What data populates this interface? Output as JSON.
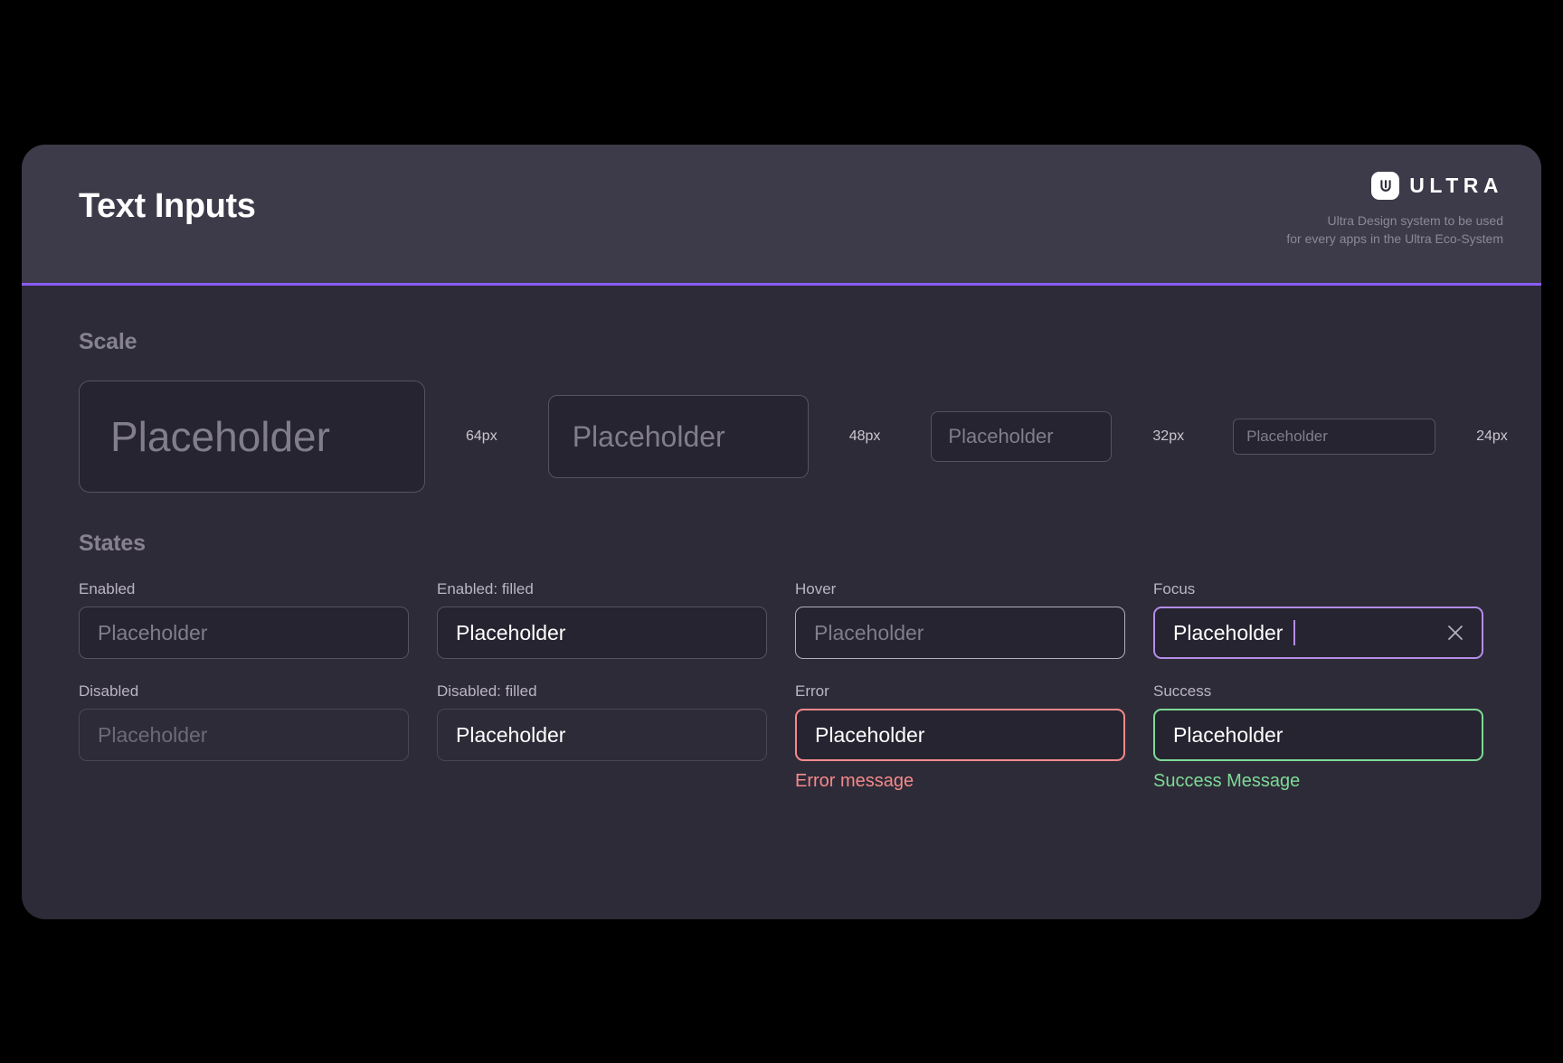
{
  "header": {
    "title": "Text Inputs",
    "brand_name": "ULTRA",
    "brand_icon": "ultra-logo-icon",
    "tagline": "Ultra Design system to be used\nfor every apps in the Ultra Eco-System",
    "accent_color": "#8b5cf6"
  },
  "scale": {
    "title": "Scale",
    "items": [
      {
        "placeholder": "Placeholder",
        "size_label": "64px"
      },
      {
        "placeholder": "Placeholder",
        "size_label": "48px"
      },
      {
        "placeholder": "Placeholder",
        "size_label": "32px"
      },
      {
        "placeholder": "Placeholder",
        "size_label": "24px"
      }
    ]
  },
  "states": {
    "title": "States",
    "row1": [
      {
        "label": "Enabled",
        "value": "Placeholder"
      },
      {
        "label": "Enabled: filled",
        "value": "Placeholder"
      },
      {
        "label": "Hover",
        "value": "Placeholder"
      },
      {
        "label": "Focus",
        "value": "Placeholder",
        "clear_icon": "close-icon"
      }
    ],
    "row2": [
      {
        "label": "Disabled",
        "value": "Placeholder"
      },
      {
        "label": "Disabled: filled",
        "value": "Placeholder"
      },
      {
        "label": "Error",
        "value": "Placeholder",
        "message": "Error message",
        "color": "#f58a8a"
      },
      {
        "label": "Success",
        "value": "Placeholder",
        "message": "Success Message",
        "color": "#7ddb96"
      }
    ]
  }
}
